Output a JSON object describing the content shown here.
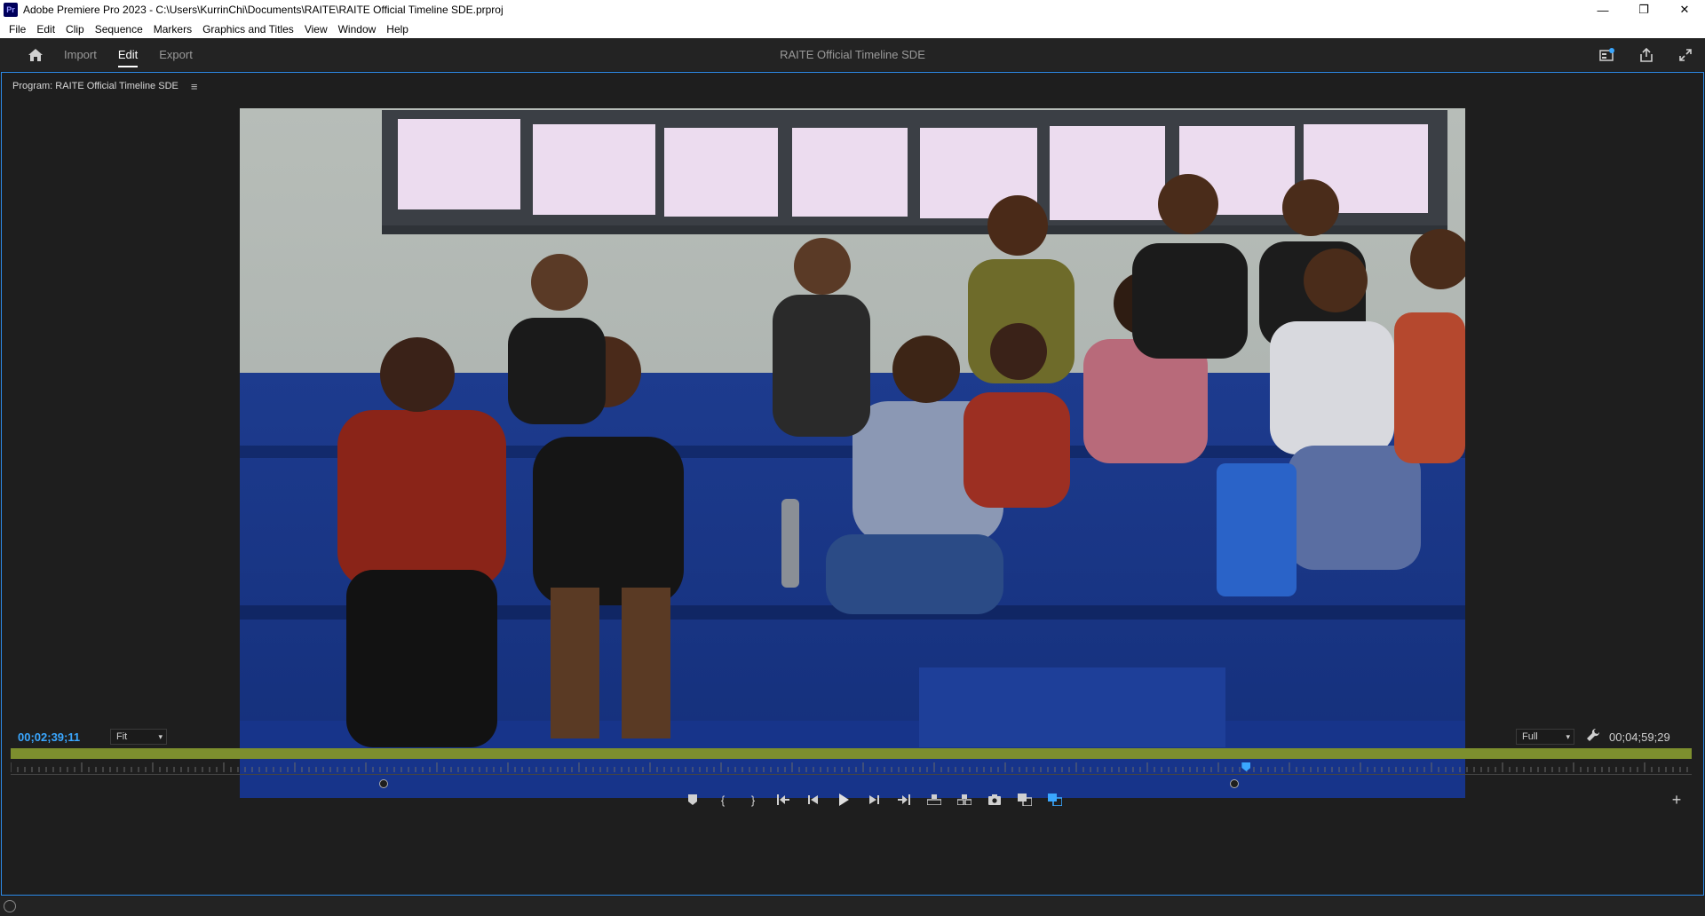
{
  "window": {
    "app_badge": "Pr",
    "title": "Adobe Premiere Pro 2023 - C:\\Users\\KurrinChi\\Documents\\RAITE\\RAITE Official Timeline SDE.prproj",
    "minimize": "—",
    "maximize": "❐",
    "close": "✕"
  },
  "menu": [
    "File",
    "Edit",
    "Clip",
    "Sequence",
    "Markers",
    "Graphics and Titles",
    "View",
    "Window",
    "Help"
  ],
  "workspace": {
    "tabs": [
      "Import",
      "Edit",
      "Export"
    ],
    "active_tab": "Edit",
    "sequence_title": "RAITE Official Timeline SDE"
  },
  "panel": {
    "title": "Program: RAITE Official Timeline SDE",
    "menu_icon": "≡"
  },
  "monitor": {
    "current_timecode": "00;02;39;11",
    "zoom_value": "Fit",
    "quality_value": "Full",
    "duration_timecode": "00;04;59;29",
    "playhead_fraction": 0.735,
    "in_point_fraction": 0.222,
    "out_point_fraction": 0.728
  },
  "transport": {
    "add_marker": "⬟",
    "mark_in": "{",
    "mark_out": "}",
    "go_to_in": "⇤",
    "step_back": "◀",
    "play": "▶",
    "step_forward": "▶",
    "go_to_out": "⇥",
    "add": "+"
  },
  "colors": {
    "accent_blue": "#3aa7ff",
    "panel_border": "#2d8ceb",
    "work_area": "#7d8f2e"
  }
}
